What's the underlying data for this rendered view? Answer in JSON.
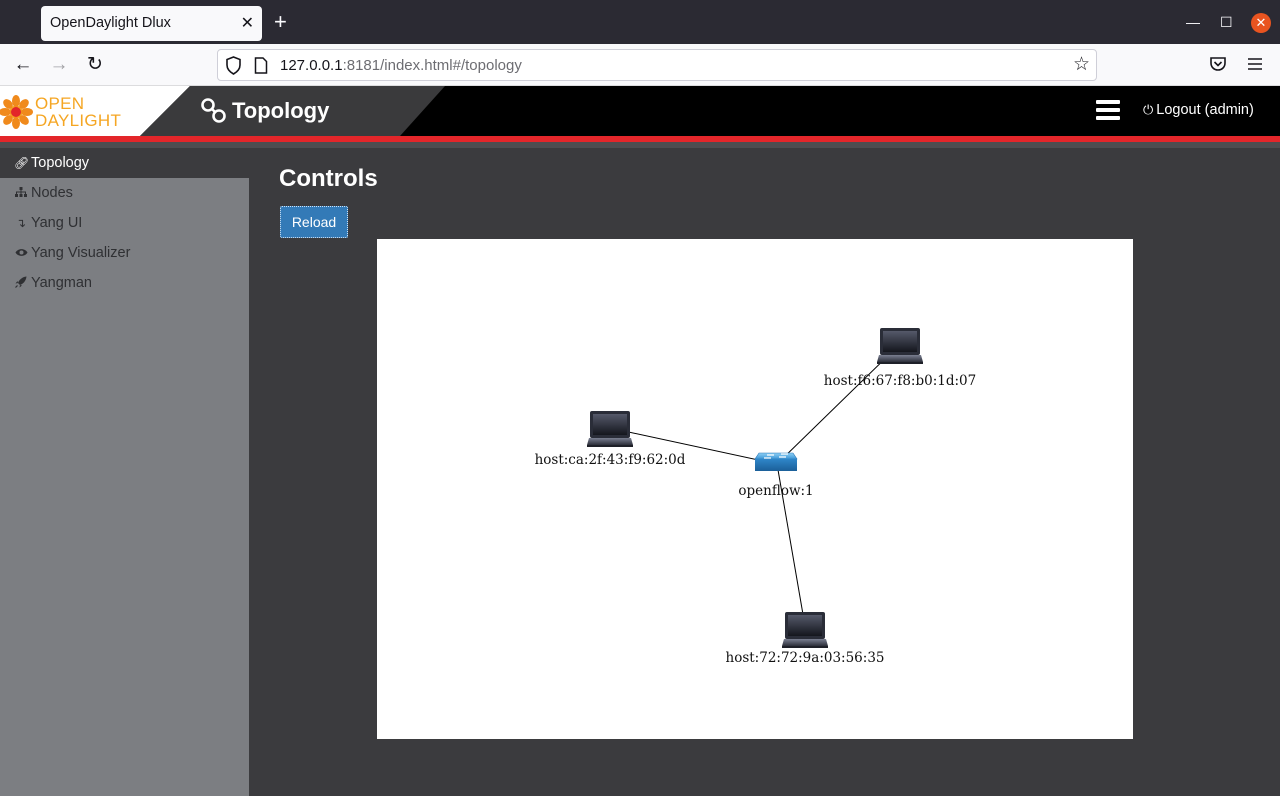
{
  "browser": {
    "tab_title": "OpenDaylight Dlux",
    "tab_close": "✕",
    "new_tab": "+",
    "url_host": "127.0.0.1",
    "url_rest": ":8181/index.html#/topology",
    "window_controls": {
      "minimize": "—",
      "maximize": "☐",
      "close": "✕"
    }
  },
  "header": {
    "logo_line1": "OPEN",
    "logo_line2": "DAYLIGHT",
    "page_title": "Topology",
    "logout_label": "Logout (admin)"
  },
  "colors": {
    "accent_red": "#e3262a",
    "button_blue": "#337ab7",
    "logo_orange": "#f5a623",
    "sidebar_gray": "#7c7e82",
    "main_bg": "#3b3b3e"
  },
  "sidebar": {
    "items": [
      {
        "label": "Topology",
        "icon": "link-icon",
        "active": true
      },
      {
        "label": "Nodes",
        "icon": "sitemap-icon",
        "active": false
      },
      {
        "label": "Yang UI",
        "icon": "level-down-icon",
        "active": false
      },
      {
        "label": "Yang Visualizer",
        "icon": "eye-icon",
        "active": false
      },
      {
        "label": "Yangman",
        "icon": "rocket-icon",
        "active": false
      }
    ]
  },
  "main": {
    "section_title": "Controls",
    "reload_label": "Reload"
  },
  "topology": {
    "nodes": [
      {
        "id": "openflow:1",
        "label": "openflow:1",
        "type": "switch"
      },
      {
        "id": "host:f6:67:f8:b0:1d:07",
        "label": "host:f6:67:f8:b0:1d:07",
        "type": "host"
      },
      {
        "id": "host:ca:2f:43:f9:62:0d",
        "label": "host:ca:2f:43:f9:62:0d",
        "type": "host"
      },
      {
        "id": "host:72:72:9a:03:56:35",
        "label": "host:72:72:9a:03:56:35",
        "type": "host"
      }
    ],
    "links": [
      {
        "source": "openflow:1",
        "target": "host:f6:67:f8:b0:1d:07"
      },
      {
        "source": "openflow:1",
        "target": "host:ca:2f:43:f9:62:0d"
      },
      {
        "source": "openflow:1",
        "target": "host:72:72:9a:03:56:35"
      }
    ]
  }
}
